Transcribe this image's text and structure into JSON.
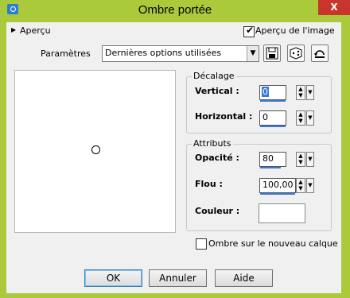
{
  "window": {
    "title": "Ombre portée",
    "close_symbol": "X"
  },
  "preview_toggle": {
    "label": "Aperçu"
  },
  "preview_check": {
    "label": "Aperçu de l'image",
    "checked": true
  },
  "parameters": {
    "label": "Paramètres",
    "preset_value": "Dernières options utilisées"
  },
  "offset_group": {
    "title": "Décalage",
    "vertical_label": "Vertical :",
    "vertical_value": "0",
    "horizontal_label": "Horizontal :",
    "horizontal_value": "0"
  },
  "attributes_group": {
    "title": "Attributs",
    "opacity_label": "Opacité :",
    "opacity_value": "80",
    "opacity_level": 0.8,
    "blur_label": "Flou :",
    "blur_value": "100,00",
    "blur_level": 1.0,
    "color_label": "Couleur :",
    "color_value": "#ffffff"
  },
  "new_layer_check": {
    "label": "Ombre sur le nouveau calque",
    "checked": false
  },
  "buttons": {
    "ok": "OK",
    "cancel": "Annuler",
    "help": "Aide"
  },
  "colors": {
    "title_bar": "#aaca3c",
    "close": "#c7352c",
    "accent": "#3a78d6"
  },
  "icons": [
    "save-icon",
    "dice-icon",
    "reset-icon",
    "camera-icon"
  ]
}
